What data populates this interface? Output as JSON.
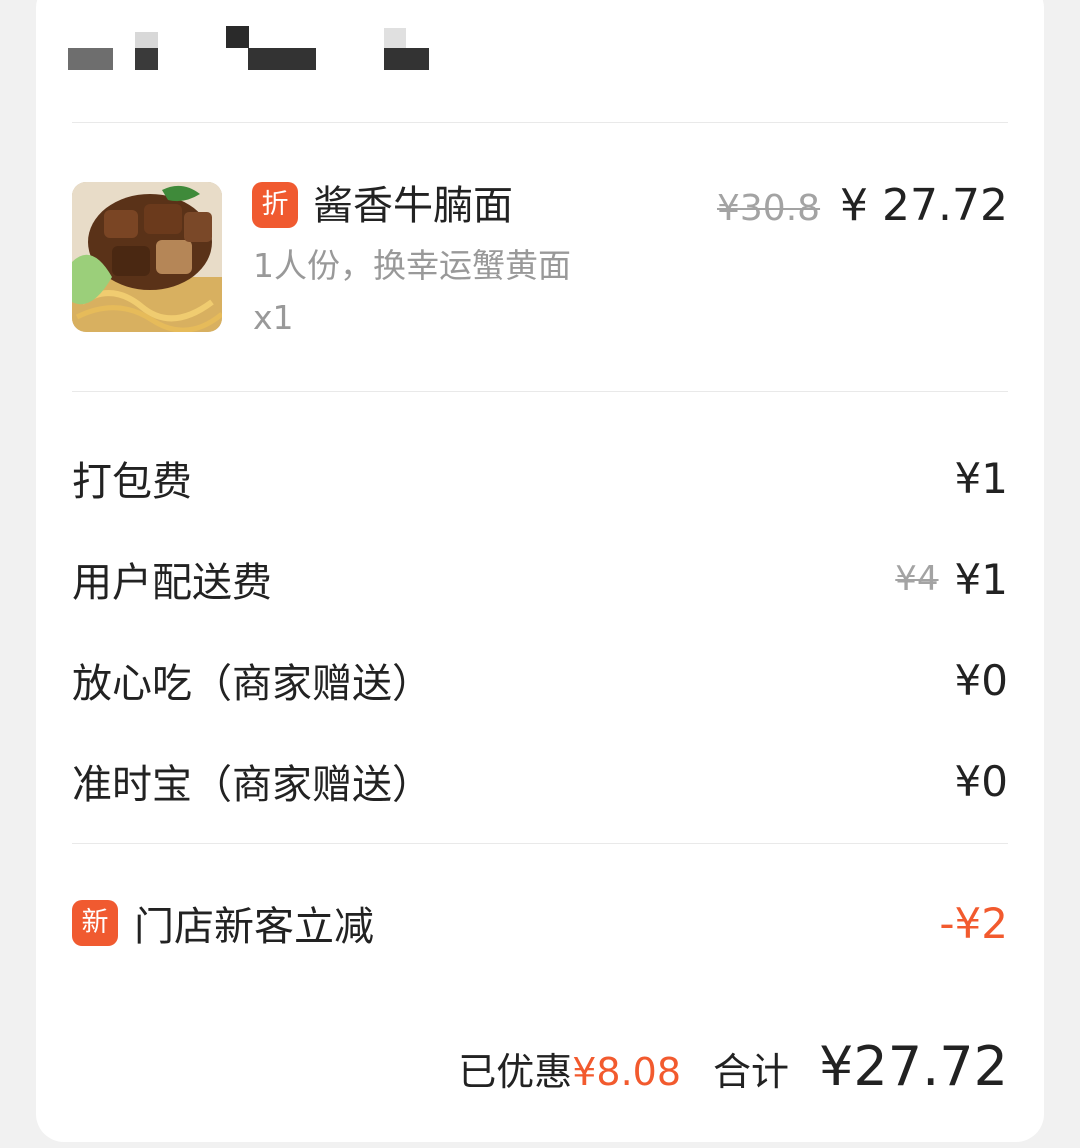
{
  "colors": {
    "accent": "#f25a2e",
    "badge_bg": "#f05a30",
    "muted_text": "#999999",
    "strike_text": "#a3a3a3",
    "card_bg": "#ffffff",
    "page_bg": "#f1f1f1"
  },
  "store": {
    "name_obscured": true
  },
  "item": {
    "image_icon": "food-photo",
    "badge": "折",
    "name": "酱香牛腩面",
    "spec": "1人份，换幸运蟹黄面",
    "qty": "x1",
    "original_price": "¥30.8",
    "price": "¥ 27.72"
  },
  "fees": [
    {
      "label": "打包费",
      "original": "",
      "value": "¥1"
    },
    {
      "label": "用户配送费",
      "original": "¥4",
      "value": "¥1"
    },
    {
      "label": "放心吃（商家赠送）",
      "original": "",
      "value": "¥0"
    },
    {
      "label": "准时宝（商家赠送）",
      "original": "",
      "value": "¥0"
    }
  ],
  "discount": {
    "badge": "新",
    "label": "门店新客立减",
    "value": "-¥2"
  },
  "summary": {
    "saved_label": "已优惠",
    "saved_amount": "¥8.08",
    "total_label": "合计",
    "total_amount": "¥27.72"
  }
}
